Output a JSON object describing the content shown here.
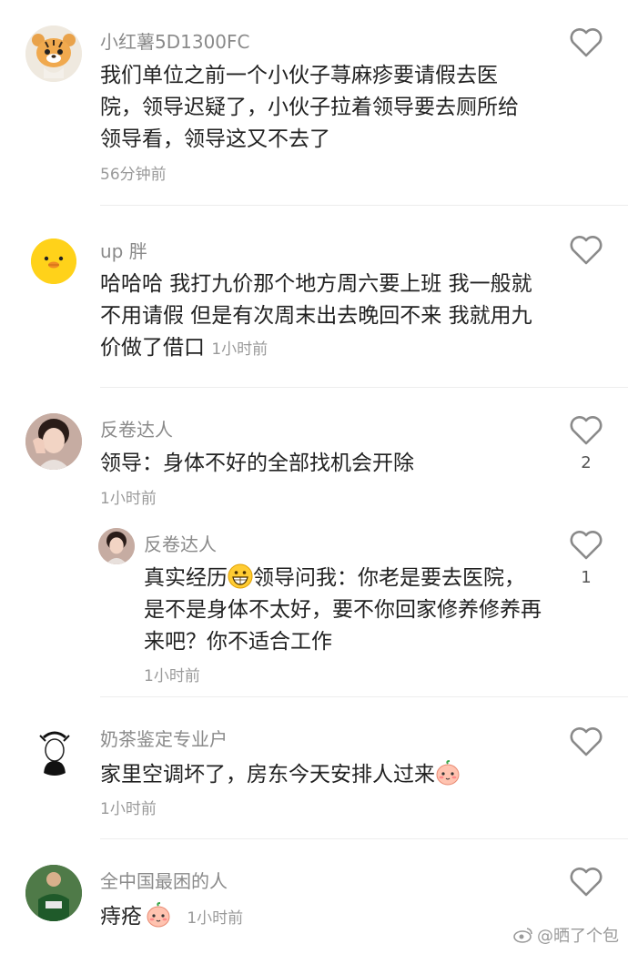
{
  "comments": [
    {
      "username": "小红薯5D1300FC",
      "text": "我们单位之前一个小伙子荨麻疹要请假去医院，领导迟疑了，小伙子拉着领导要去厕所给领导看，领导这又不去了",
      "time": "56分钟前"
    },
    {
      "username": "up 胖",
      "text": "哈哈哈 我打九价那个地方周六要上班 我一般就不用请假 但是有次周末出去晚回不来 我就用九价做了借口",
      "time": "1小时前"
    },
    {
      "username": "反卷达人",
      "text": "领导：身体不好的全部找机会开除",
      "time": "1小时前",
      "like_count": "2"
    },
    {
      "username": "反卷达人",
      "text_prefix": "真实经历",
      "text_rest": "领导问我：你老是要去医院，是不是身体不太好，要不你回家修养修养再来吧？你不适合工作",
      "time": "1小时前",
      "like_count": "1"
    },
    {
      "username": "奶茶鉴定专业户",
      "text": "家里空调坏了，房东今天安排人过来",
      "time": "1小时前"
    },
    {
      "username": "全中国最困的人",
      "text": "痔疮",
      "time": "1小时前"
    }
  ],
  "watermark": "@晒了个包",
  "icons": {
    "like": "heart-outline-icon",
    "grin": "grinning-face-emoji",
    "peach": "peach-face-emoji"
  }
}
